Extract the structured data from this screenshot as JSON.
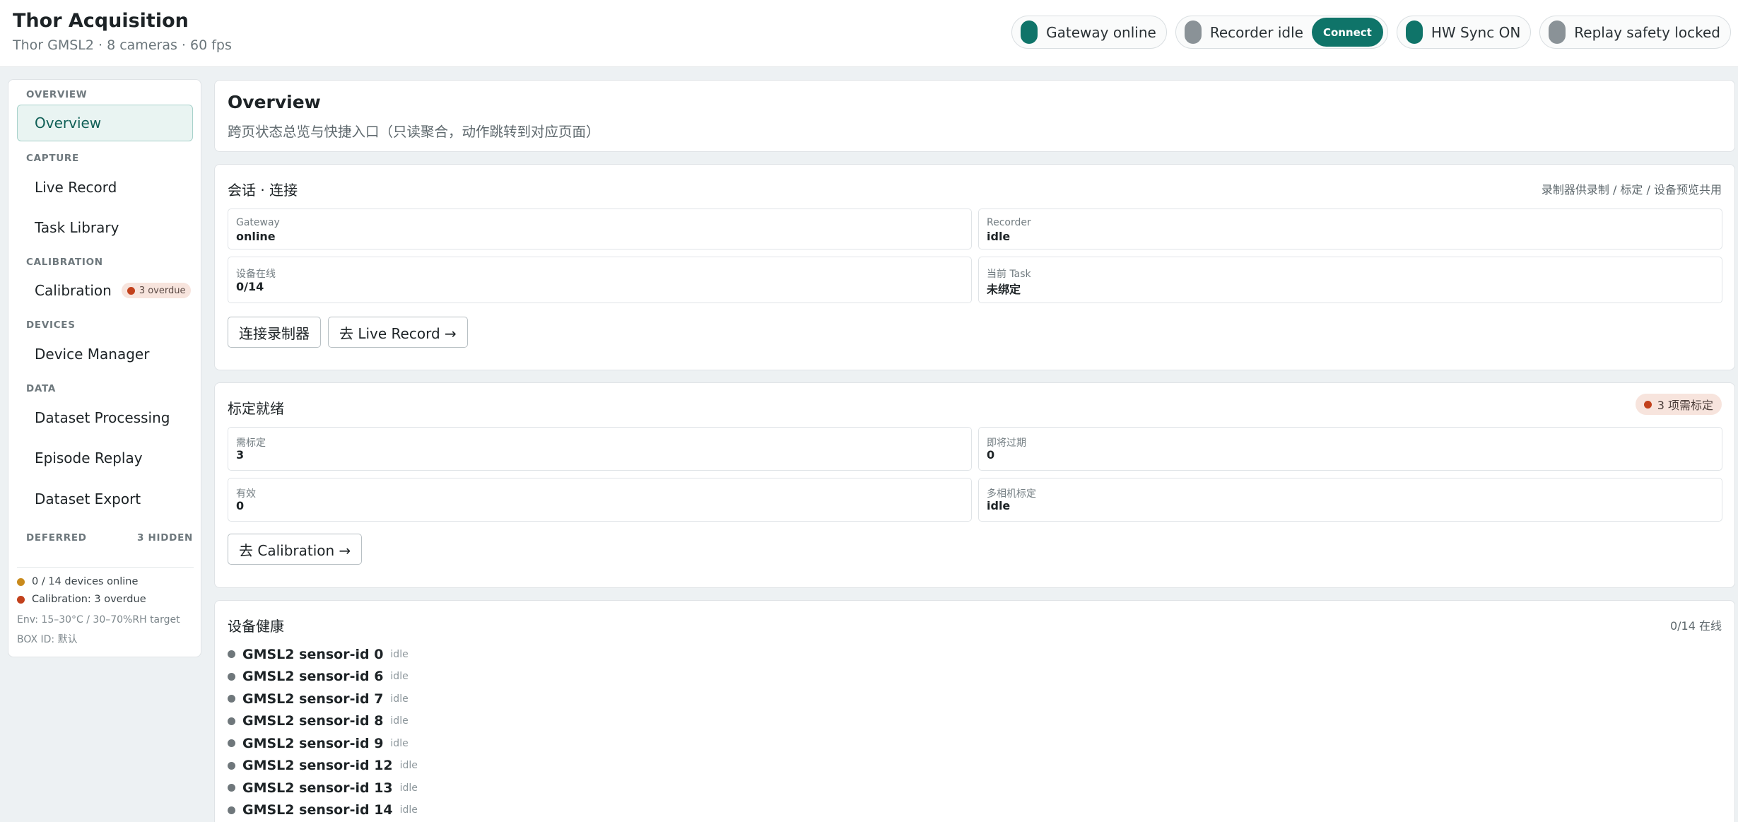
{
  "header": {
    "title": "Thor Acquisition",
    "subtitle": "Thor GMSL2 · 8 cameras · 60 fps",
    "pills": [
      {
        "label": "Gateway online",
        "state_color": "#0f7469"
      },
      {
        "label": "Recorder idle",
        "state_color": "#8a9297",
        "action": "Connect"
      },
      {
        "label": "HW Sync ON",
        "state_color": "#0f7469"
      },
      {
        "label": "Replay safety locked",
        "state_color": "#8a9297"
      }
    ]
  },
  "sidebar": {
    "sections": {
      "overview": "OVERVIEW",
      "capture": "CAPTURE",
      "calibration": "CALIBRATION",
      "devices": "DEVICES",
      "data": "DATA",
      "deferred": "DEFERRED",
      "deferred_count": "3 HIDDEN"
    },
    "items": {
      "overview": "Overview",
      "live_record": "Live Record",
      "task_library": "Task Library",
      "calibration": "Calibration",
      "calibration_badge": "3 overdue",
      "device_manager": "Device Manager",
      "dataset_processing": "Dataset Processing",
      "episode_replay": "Episode Replay",
      "dataset_export": "Dataset Export"
    },
    "active_item": "Overview",
    "status": {
      "devices": "0 / 14 devices online",
      "calibration": "Calibration: 3 overdue",
      "env": "Env: 15–30°C / 30–70%RH target",
      "box_id": "BOX ID: 默认"
    }
  },
  "main": {
    "title": "Overview",
    "subtitle": "跨页状态总览与快捷入口（只读聚合，动作跳转到对应页面）",
    "session": {
      "title": "会话 · 连接",
      "note": "录制器供录制 / 标定 / 设备预览共用",
      "fields": [
        {
          "label": "Gateway",
          "value": "online"
        },
        {
          "label": "Recorder",
          "value": "idle"
        },
        {
          "label": "设备在线",
          "value": "0/14"
        },
        {
          "label": "当前 Task",
          "value": "未绑定"
        }
      ],
      "buttons": {
        "connect": "连接录制器",
        "goto_live": "去 Live Record →"
      }
    },
    "calibration": {
      "title": "标定就绪",
      "badge": "3 项需标定",
      "fields": [
        {
          "label": "需标定",
          "value": "3"
        },
        {
          "label": "即将过期",
          "value": "0"
        },
        {
          "label": "有效",
          "value": "0"
        },
        {
          "label": "多相机标定",
          "value": "idle"
        }
      ],
      "buttons": {
        "goto_calibration": "去 Calibration →"
      }
    },
    "device_health": {
      "title": "设备健康",
      "summary": "0/14 在线",
      "devices": [
        {
          "name": "GMSL2 sensor-id 0",
          "state": "idle"
        },
        {
          "name": "GMSL2 sensor-id 6",
          "state": "idle"
        },
        {
          "name": "GMSL2 sensor-id 7",
          "state": "idle"
        },
        {
          "name": "GMSL2 sensor-id 8",
          "state": "idle"
        },
        {
          "name": "GMSL2 sensor-id 9",
          "state": "idle"
        },
        {
          "name": "GMSL2 sensor-id 12",
          "state": "idle"
        },
        {
          "name": "GMSL2 sensor-id 13",
          "state": "idle"
        },
        {
          "name": "GMSL2 sensor-id 14",
          "state": "idle"
        }
      ]
    }
  },
  "colors": {
    "accent": "#0f7469",
    "warning": "#c2411c",
    "amber": "#c98a1c",
    "idle": "#8a9297"
  }
}
